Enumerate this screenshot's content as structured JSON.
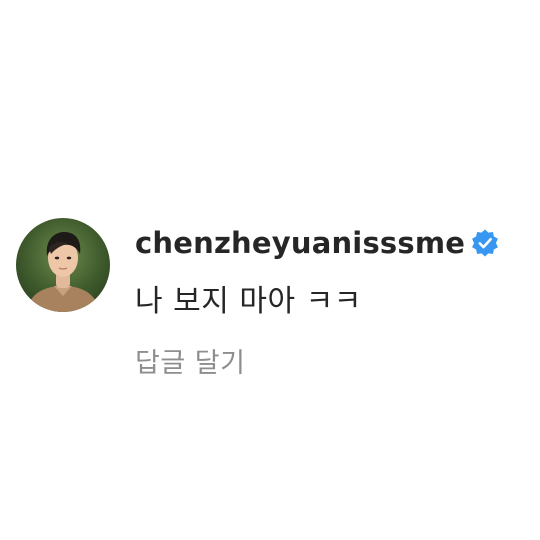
{
  "comment": {
    "avatar_icon": "profile-photo",
    "username": "chenzheyuanisssme",
    "verified_icon": "verified-badge-icon",
    "verified_color": "#3897f0",
    "text": "나 보지 마아 ㅋㅋ",
    "reply_label": "답글 달기"
  }
}
